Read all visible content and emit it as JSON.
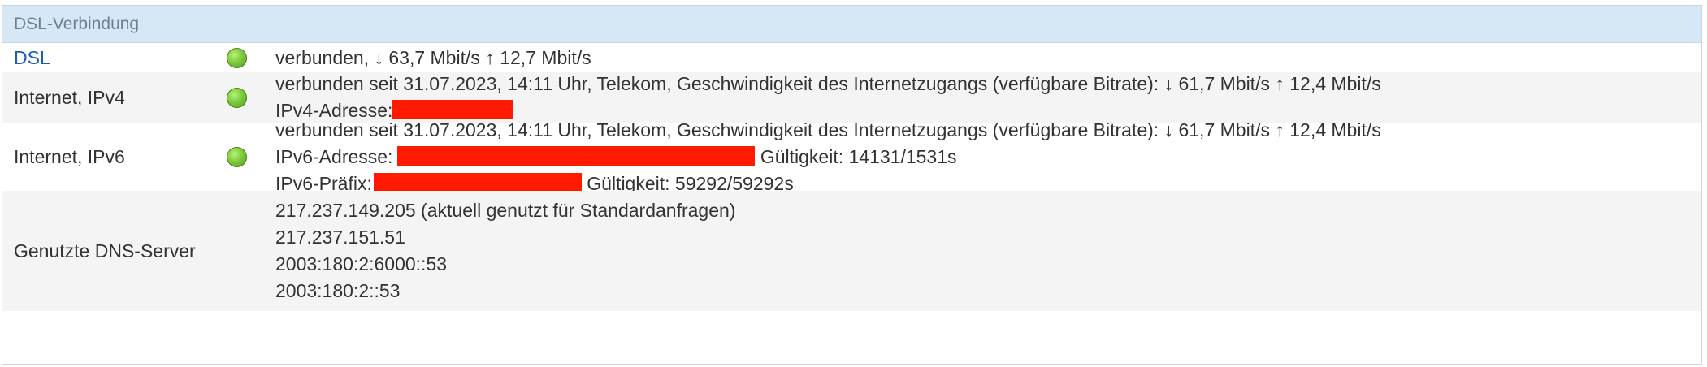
{
  "header": {
    "title": "DSL-Verbindung"
  },
  "rows": {
    "dsl": {
      "label": "DSL",
      "status": "connected",
      "line1": "verbunden, ↓ 63,7 Mbit/s ↑ 12,7 Mbit/s"
    },
    "ipv4": {
      "label": "Internet, IPv4",
      "status": "connected",
      "line1": "verbunden seit 31.07.2023, 14:11 Uhr, Telekom, Geschwindigkeit des Internetzugangs (verfügbare Bitrate): ↓ 61,7 Mbit/s ↑ 12,4 Mbit/s",
      "address_label": "IPv4-Adresse:"
    },
    "ipv6": {
      "label": "Internet, IPv6",
      "status": "connected",
      "line1": "verbunden seit 31.07.2023, 14:11 Uhr, Telekom, Geschwindigkeit des Internetzugangs (verfügbare Bitrate): ↓ 61,7 Mbit/s ↑ 12,4 Mbit/s",
      "address_label": "IPv6-Adresse:",
      "address_validity": "Gültigkeit: 14131/1531s",
      "prefix_label": "IPv6-Präfix:",
      "prefix_validity": "Gültigkeit: 59292/59292s"
    },
    "dns": {
      "label": "Genutzte DNS-Server",
      "servers": [
        "217.237.149.205 (aktuell genutzt für Standardanfragen)",
        "217.237.151.51",
        "2003:180:2:6000::53",
        "2003:180:2::53"
      ]
    }
  },
  "colors": {
    "header_bg": "#d6e7f6",
    "status_led": "#7cc83a",
    "redaction": "#ff1a00",
    "link": "#1a5fb4"
  }
}
